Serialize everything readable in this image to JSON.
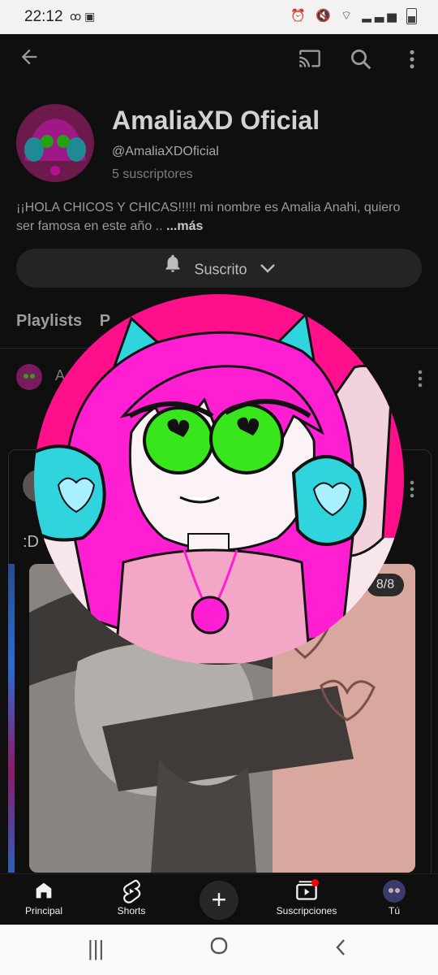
{
  "status_bar": {
    "time": "22:12",
    "left_icons": "ꝏ ▣",
    "right_icons": "⏰ 🔇 ✆ ᵛᵒˡᵗᵉ ▮"
  },
  "channel": {
    "name": "AmaliaXD Oficial",
    "handle": "@AmaliaXDOficial",
    "subscribers": "5 suscriptores",
    "description": "¡¡HOLA CHICOS Y CHICAS!!!!! mi nombre es Amalia Anahi, quiero ser famosa en este año .. ",
    "more_label": "...más",
    "subscribe_label": "Suscrito"
  },
  "tabs": {
    "playlists": "Playlists",
    "partial": "P"
  },
  "post": {
    "author_initial": "A",
    "text": ":D",
    "image_counter": "8/8"
  },
  "bottom_nav": {
    "items": [
      {
        "label": "Principal",
        "icon": "home-icon"
      },
      {
        "label": "Shorts",
        "icon": "shorts-icon"
      },
      {
        "label": "",
        "icon": "plus-icon"
      },
      {
        "label": "Suscripciones",
        "icon": "subscriptions-icon"
      },
      {
        "label": "Tú",
        "icon": "avatar-icon"
      }
    ]
  },
  "colors": {
    "avatar_pink": "#ff0f8a",
    "avatar_cyan": "#2fd4dc",
    "avatar_magenta": "#ff1ed2",
    "eye_green": "#38e61c"
  }
}
